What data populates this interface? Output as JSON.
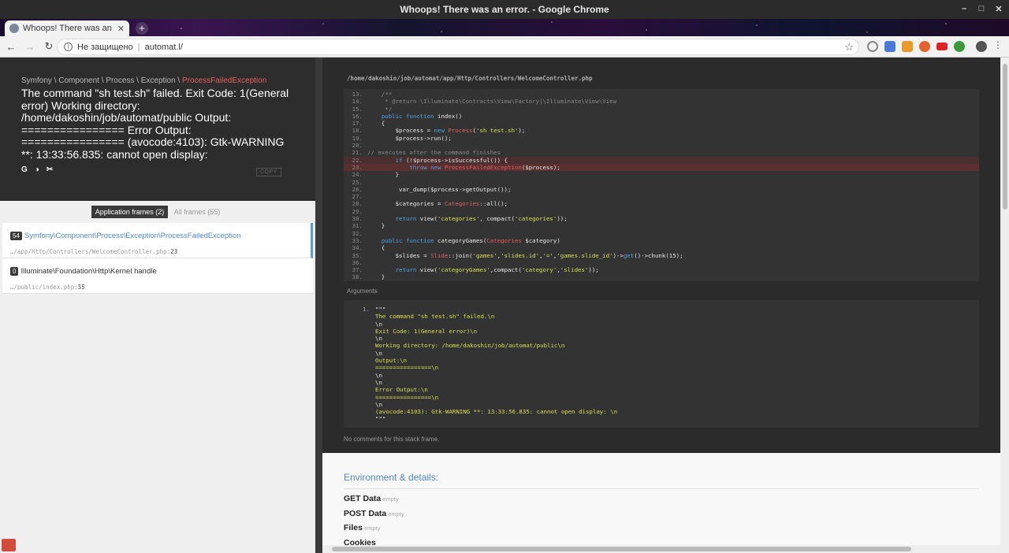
{
  "window": {
    "title": "Whoops! There was an error. - Google Chrome",
    "minimize": "–",
    "maximize": "□",
    "close": "✕"
  },
  "tab": {
    "title": "Whoops! There was an err",
    "close": "✕",
    "new_tab": "+"
  },
  "toolbar": {
    "back": "←",
    "forward": "→",
    "reload": "↻",
    "insecure_label": "Не защищено",
    "url": "automat.l/",
    "bookmark": "☆"
  },
  "header": {
    "crumb_prefix": "Symfony \\ Component \\ Process \\ Exception \\ ",
    "exception_name": "ProcessFailedException",
    "message": "The command \"sh test.sh\" failed. Exit Code: 1(General error) Working directory: /home/dakoshin/job/automat/public Output: ================ Error Output: ================ (avocode:4103): Gtk-WARNING **: 13:33:56.835: cannot open display:",
    "icons": [
      "G",
      "◑",
      "✂"
    ],
    "copy": "COPY"
  },
  "frame_switch": {
    "app": "Application frames (2)",
    "all": "All frames (55)"
  },
  "frames": [
    {
      "index": "54",
      "cls": "Symfony\\Component\\Process\\Exception\\ProcessFailedException",
      "file": "…/app/Http/Controllers/WelcomeController.php",
      "line": "23"
    },
    {
      "index": "0",
      "cls": "Illuminate\\Foundation\\Http\\Kernel handle",
      "file": "…/public/index.php",
      "line": "55"
    }
  ],
  "code": {
    "path": "/home/dakoshin/job/automat/app/Http/Controllers/WelcomeController.php",
    "lines": [
      {
        "n": "13.",
        "t": "    /**"
      },
      {
        "n": "14.",
        "t": "     * @return \\Illuminate\\Contracts\\View\\Factory|\\Illuminate\\View\\View"
      },
      {
        "n": "15.",
        "t": "     */"
      },
      {
        "n": "16.",
        "t": "    public function index()"
      },
      {
        "n": "17.",
        "t": "    {"
      },
      {
        "n": "18.",
        "t": "        $process = new Process('sh test.sh');"
      },
      {
        "n": "19.",
        "t": "        $process->run();"
      },
      {
        "n": "20.",
        "t": ""
      },
      {
        "n": "21.",
        "t": "// executes after the command finishes"
      },
      {
        "n": "22.",
        "t": "        if (!$process->isSuccessful()) {"
      },
      {
        "n": "23.",
        "t": "            throw new ProcessFailedException($process);"
      },
      {
        "n": "24.",
        "t": "        }"
      },
      {
        "n": "25.",
        "t": ""
      },
      {
        "n": "26.",
        "t": "         var_dump($process->getOutput());"
      },
      {
        "n": "27.",
        "t": ""
      },
      {
        "n": "28.",
        "t": "        $categories = Categories::all();"
      },
      {
        "n": "29.",
        "t": ""
      },
      {
        "n": "30.",
        "t": "        return view('categories', compact('categories'));"
      },
      {
        "n": "31.",
        "t": "    }"
      },
      {
        "n": "32.",
        "t": ""
      },
      {
        "n": "33.",
        "t": "    public function categoryGames(Categories $category)"
      },
      {
        "n": "34.",
        "t": "    {"
      },
      {
        "n": "35.",
        "t": "        $slides = Slide::join('games','slides.id','=','games.slide_id')->get()->chunk(15);"
      },
      {
        "n": "36.",
        "t": ""
      },
      {
        "n": "37.",
        "t": "        return view('categoryGames',compact('category','slides'));"
      },
      {
        "n": "38.",
        "t": "    }"
      }
    ]
  },
  "arguments": {
    "label": "Arguments",
    "index": "1.",
    "lines": [
      "\"\"\"",
      "The command \"sh test.sh\" failed.\\n",
      "\\n",
      "Exit Code: 1(General error)\\n",
      "\\n",
      "Working directory: /home/dakoshin/job/automat/public\\n",
      "\\n",
      "Output:\\n",
      "================\\n",
      "\\n",
      "\\n",
      "Error Output:\\n",
      "================\\n",
      "\\n",
      "(avocode:4103): Gtk-WARNING **: 13:33:56.835: cannot open display: \\n",
      "\"\"\""
    ]
  },
  "no_comments": "No comments for this stack frame.",
  "environment": {
    "title": "Environment & details:",
    "rows": [
      {
        "name": "GET Data",
        "value": "empty"
      },
      {
        "name": "POST Data",
        "value": "empty"
      },
      {
        "name": "Files",
        "value": "empty"
      },
      {
        "name": "Cookies",
        "value": ""
      }
    ]
  }
}
